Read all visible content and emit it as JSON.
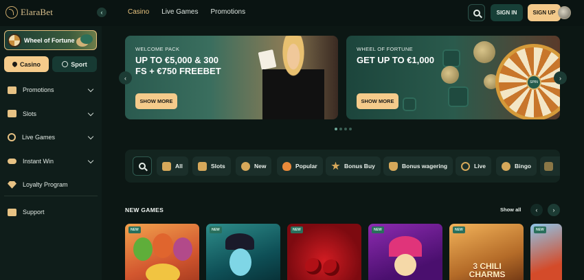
{
  "brand": {
    "name": "ElaraBet"
  },
  "top_nav": {
    "items": [
      "Casino",
      "Live Games",
      "Promotions"
    ],
    "active": "Casino"
  },
  "auth": {
    "sign_in": "SIGN IN",
    "sign_up": "SIGN UP"
  },
  "sidebar": {
    "featured": "Wheel of Fortune",
    "toggle": {
      "casino": "Casino",
      "sport": "Sport"
    },
    "items": [
      {
        "label": "Promotions",
        "icon": "gift-icon",
        "expandable": true
      },
      {
        "label": "Slots",
        "icon": "slot-machine-icon",
        "expandable": true
      },
      {
        "label": "Live Games",
        "icon": "live-chip-icon",
        "expandable": true
      },
      {
        "label": "Instant Win",
        "icon": "gamepad-icon",
        "expandable": true
      },
      {
        "label": "Loyalty Program",
        "icon": "diamond-icon",
        "expandable": false
      }
    ],
    "support": "Support"
  },
  "banners": [
    {
      "kicker": "WELCOME PACK",
      "title": "UP TO €5,000 & 300 FS + €750 FREEBET",
      "button": "SHOW MORE"
    },
    {
      "kicker": "WHEEL OF FORTUNE",
      "title": "GET UP TO €1,000",
      "button": "SHOW MORE"
    }
  ],
  "wheel_hub_text": "SPIN",
  "carousel": {
    "pages": 4,
    "active": 0
  },
  "categories": [
    "All",
    "Slots",
    "New",
    "Popular",
    "Bonus Buy",
    "Bonus wagering",
    "Live",
    "Bingo"
  ],
  "new_games": {
    "title": "NEW GAMES",
    "show_all": "Show all",
    "tag": "NEW",
    "tile_3_text": "3 CHILI CHARMS"
  },
  "colors": {
    "accent": "#f5cb8b",
    "bg": "#0b1513",
    "panel": "#13241f",
    "green": "#173f37"
  }
}
